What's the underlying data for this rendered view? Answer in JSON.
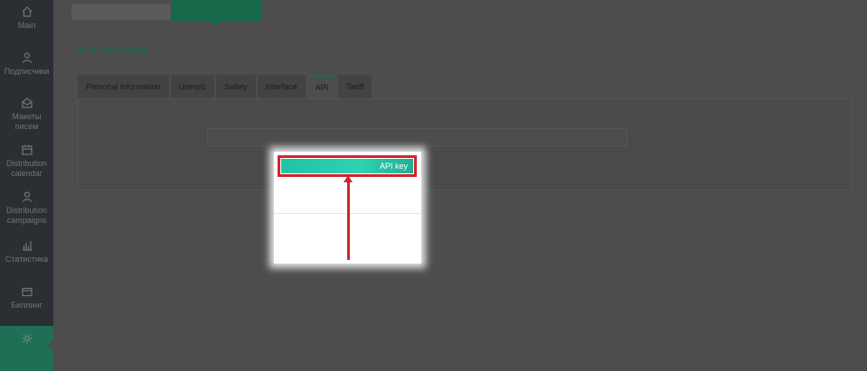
{
  "sidebar": {
    "items": [
      {
        "label": "Main",
        "icon": "home-icon"
      },
      {
        "label": "Подписчики",
        "icon": "subscribers-icon"
      },
      {
        "label": "Макеты писем",
        "icon": "templates-icon"
      },
      {
        "label": "Distribution calendar",
        "icon": "calendar-icon"
      },
      {
        "label": "Distribution campaigns",
        "icon": "campaigns-icon"
      },
      {
        "label": "Статистика",
        "icon": "statistics-icon"
      },
      {
        "label": "Биллинг",
        "icon": "billing-icon"
      },
      {
        "label": "",
        "icon": "gear-icon",
        "active": true
      }
    ]
  },
  "settings": {
    "title": "MY SETTINGS",
    "tabs": [
      {
        "label": "Personal information"
      },
      {
        "label": "Userpic"
      },
      {
        "label": "Safety"
      },
      {
        "label": "Interface"
      },
      {
        "label": "API",
        "active": true
      },
      {
        "label": "Tariff"
      }
    ]
  },
  "highlight": {
    "button_label": "API key"
  },
  "colors": {
    "accent": "#1d6b4f",
    "button": "#2fd1b2",
    "annotation": "#d0262b"
  }
}
